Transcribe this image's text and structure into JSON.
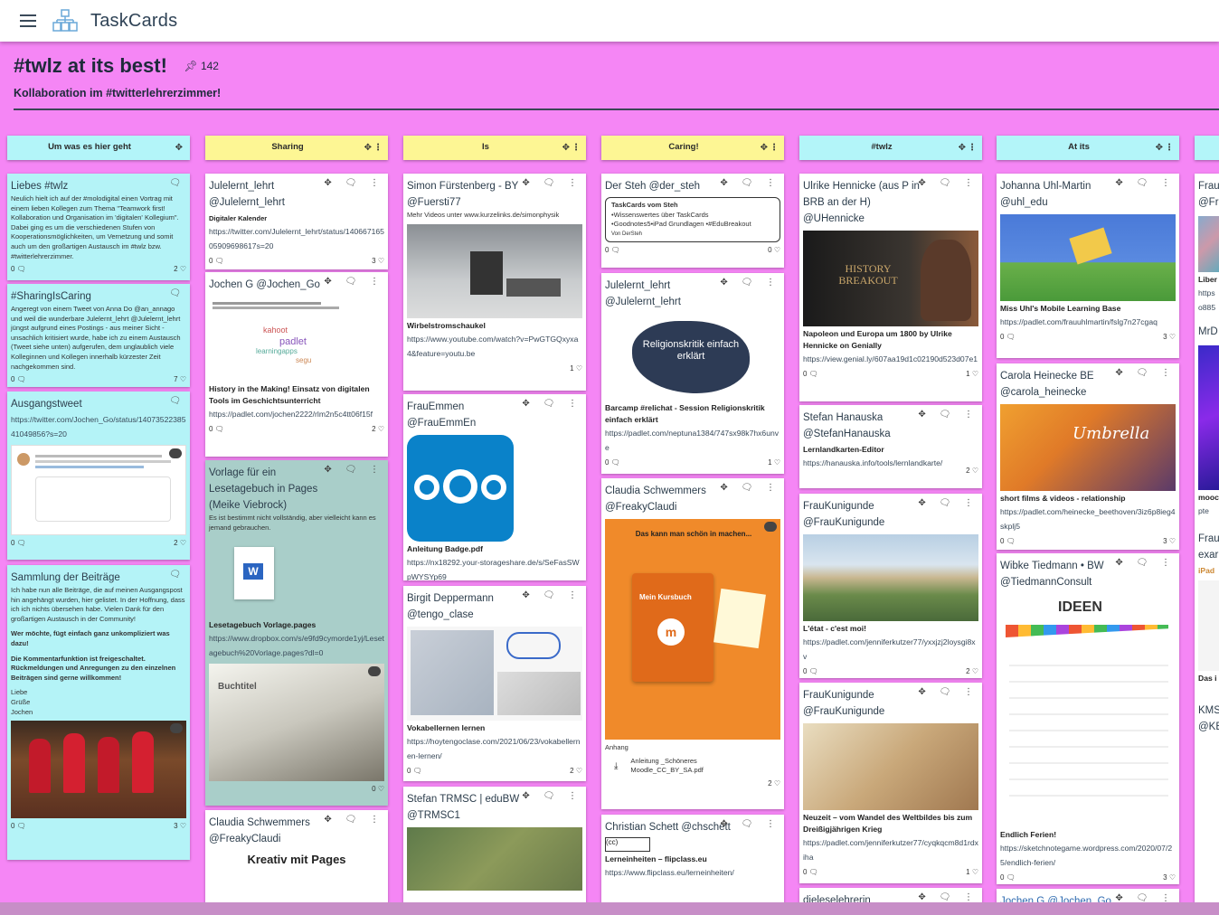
{
  "app": {
    "title": "TaskCards"
  },
  "board": {
    "title": "#twlz at its best!",
    "pin_count": "142",
    "subtitle": "Kollaboration im #twitterlehrerzimmer!"
  },
  "columns": [
    {
      "title": "Um was es hier geht",
      "color": "#b3f5f9"
    },
    {
      "title": "Sharing",
      "color": "#fdf694"
    },
    {
      "title": "Is",
      "color": "#fdf694"
    },
    {
      "title": "Caring!",
      "color": "#fdf694"
    },
    {
      "title": "#twlz",
      "color": "#b3f5f9"
    },
    {
      "title": "At its",
      "color": "#b3f5f9"
    }
  ],
  "cards": {
    "c1": {
      "title": "Liebes #twlz",
      "text": "Neulich hielt ich auf der #molodigital einen Vortrag mit einem lieben Kollegen zum Thema \"Teamwork first! Kollaboration und Organisation im 'digitalen' Kollegium\". Dabei ging es um die verschiedenen Stufen von Kooperationsmöglichkeiten, um Vernetzung und somit auch um den großartigen Austausch im #twlz bzw. #twitterlehrerzimmer.",
      "comments": "0",
      "likes": "2"
    },
    "c2": {
      "title": "#SharingIsCaring",
      "text": "Angeregt von einem Tweet von Anna Do @an_annago und weil die wunderbare Julelernt_lehrt @Julelernt_lehrt jüngst aufgrund eines Postings - aus meiner Sicht - unsachlich kritisiert wurde, habe ich zu einem Austausch (Tweet siehe unten) aufgerufen, dem unglaublich viele Kolleginnen und Kollegen innerhalb kürzester Zeit nachgekommen sind.",
      "comments": "0",
      "likes": "7"
    },
    "c3": {
      "title": "Ausgangstweet",
      "link": "https://twitter.com/Jochen_Go/status/1407352238541049856?s=20",
      "comments": "0",
      "likes": "2"
    },
    "c4": {
      "title": "Sammlung der Beiträge",
      "text1": "Ich habe nun alle Beiträge, die auf meinen Ausgangspost hin angehängt wurden, hier gelistet. In der Hoffnung, dass ich ich nichts übersehen habe. Vielen Dank für den großartigen Austausch in der Community!",
      "text2": "Wer möchte, fügt einfach ganz unkompliziert was dazu!",
      "text3": "Die Kommentarfunktion ist freigeschaltet. Rückmeldungen und Anregungen zu den einzelnen Beiträgen sind gerne willkommen!",
      "text4": "Liebe Grüße Jochen",
      "comments": "0",
      "likes": "3"
    },
    "s1": {
      "title": "Julelernt_lehrt @Julelernt_lehrt",
      "sub": "Digitaler Kalender",
      "link": "https://twitter.com/Julelernt_lehrt/status/14066716505909698617s=20",
      "comments": "0",
      "likes": "3"
    },
    "s2": {
      "title": "Jochen G @Jochen_Go",
      "sub": "History in the Making! Einsatz von digitalen Tools im Geschichtsunterricht",
      "link": "https://padlet.com/jochen2222/rlm2n5c4tt06f15f",
      "comments": "0",
      "likes": "2"
    },
    "s3": {
      "title": "Vorlage für ein Lesetagebuch in Pages (Meike Viebrock)",
      "text": "Es ist bestimmt nicht vollständig, aber vielleicht kann es jemand gebrauchen.",
      "file": "Lesetagebuch Vorlage.pages",
      "link": "https://www.dropbox.com/s/e9fd9cymorde1yj/Lesetagebuch%20Vorlage.pages?dl=0",
      "img_label": "Buchtitel",
      "likes": "0"
    },
    "s4": {
      "title": "Claudia Schwemmers @FreakyClaudi",
      "sub": "Kreativ mit Pages"
    },
    "i1": {
      "title": "Simon Fürstenberg - BY @Fuersti77",
      "text": "Mehr Videos unter www.kurzelinks.de/simonphysik",
      "sub": "Wirbelstromschaukel",
      "link": "https://www.youtube.com/watch?v=PwGTGQxyxa4&feature=youtu.be",
      "likes": "1"
    },
    "i2": {
      "title": "FrauEmmen @FrauEmmEn",
      "sub": "Anleitung Badge.pdf",
      "link": "https://nx18292.your-storageshare.de/s/SeFasSWpWYSYp69",
      "comments": "0",
      "likes": "1"
    },
    "i3": {
      "title": "Birgit Deppermann @tengo_clase",
      "sub": "Vokabellernen lernen",
      "link": "https://hoytengoclase.com/2021/06/23/vokabellernen-lernen/",
      "comments": "0",
      "likes": "2"
    },
    "i4": {
      "title": "Stefan TRMSC | eduBW @TRMSC1"
    },
    "ca1": {
      "title": "Der Steh @der_steh",
      "box_title": "TaskCards vom Steh",
      "box_l1": "•Wissenswertes über TaskCards",
      "box_l2": "•Goodnotes5•iPad Grundlagen •#EduBreakout",
      "box_l3": "Von DerSteh",
      "comments": "0",
      "likes": "0"
    },
    "ca2": {
      "title": "Julelernt_lehrt @Julelernt_lehrt",
      "img_text": "Religionskritik einfach erklärt",
      "sub": "Barcamp #relichat - Session Religionskritik einfach erklärt",
      "link": "https://padlet.com/neptuna1384/747sx98k7hx6unve",
      "comments": "0",
      "likes": "1"
    },
    "ca3": {
      "title": "Claudia Schwemmers @FreakyClaudi",
      "img_head": "Das kann man schön in machen...",
      "img_course": "Mein Kursbuch",
      "sub": "Anhang",
      "file": "Anleitung _Schöneres Moodle_CC_BY_SA.pdf",
      "likes": "2"
    },
    "ca4": {
      "title": "Christian Schett @chschett",
      "sub": "Lerneinheiten – flipclass.eu",
      "link": "https://www.flipclass.eu/lerneinheiten/"
    },
    "t1": {
      "title": "Ulrike Hennicke (aus P in BRB an der H) @UHennicke",
      "img_text": "HISTORY BREAKOUT",
      "sub": "Napoleon und Europa um 1800 by Ulrike Hennicke on Genially",
      "link": "https://view.genial.ly/607aa19d1c02190d523d07e1",
      "comments": "0",
      "likes": "1"
    },
    "t2": {
      "title": "Stefan Hanauska @StefanHanauska",
      "sub": "Lernlandkarten-Editor",
      "link": "https://hanauska.info/tools/lernlandkarte/",
      "likes": "2"
    },
    "t3": {
      "title": "FrauKunigunde @FrauKunigunde",
      "sub": "L'état - c'est moi!",
      "link": "https://padlet.com/jenniferkutzer77/yxxjzj2loysgi8xv",
      "comments": "0",
      "likes": "2"
    },
    "t4": {
      "title": "FrauKunigunde @FrauKunigunde",
      "sub": "Neuzeit – vom Wandel des Weltbildes bis zum Dreißigjährigen Krieg",
      "link": "https://padlet.com/jenniferkutzer77/cyqkqcm8d1rdxiha",
      "comments": "0",
      "likes": "1"
    },
    "t5": {
      "title": "dieleselehrerin"
    },
    "a1": {
      "title": "Johanna Uhl-Martin @uhl_edu",
      "sub": "Miss Uhl's Mobile Learning Base",
      "link": "https://padlet.com/frauuhlmartin/fslg7n27cgaq",
      "comments": "0",
      "likes": "3"
    },
    "a2": {
      "title": "Carola Heinecke BE @carola_heinecke",
      "img_text": "Umbrella",
      "sub": "short films & videos - relationship",
      "link": "https://padlet.com/heinecke_beethoven/3iz6p8ieg4skplj5",
      "comments": "0",
      "likes": "3"
    },
    "a3": {
      "title": "Wibke Tiedmann • BW @TiedmannConsult",
      "img_text": "IDEEN",
      "sub": "Endlich Ferien!",
      "link": "https://sketchnotegame.wordpress.com/2020/07/25/endlich-ferien/",
      "comments": "0",
      "likes": "3"
    },
    "a4": {
      "title": "Jochen G @Jochen_Go"
    }
  },
  "edge": {
    "c1": "Frau",
    "c2": "@Fr",
    "c3": "Liber",
    "c4": "https",
    "c5": "o885",
    "c6": "MrD",
    "c7": "mooc",
    "c8": "pte",
    "c9": "Frau",
    "c10": "exar",
    "c11": "iPad",
    "c12": "Das i",
    "c13": "KMS",
    "c14": "@KE"
  }
}
